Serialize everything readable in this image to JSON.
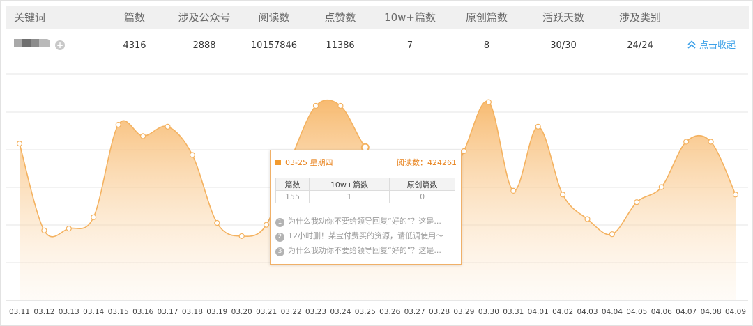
{
  "table": {
    "headers": [
      "关键词",
      "篇数",
      "涉及公众号",
      "阅读数",
      "点赞数",
      "10w+篇数",
      "原创篇数",
      "活跃天数",
      "涉及类别"
    ],
    "row": {
      "plus_icon": "+",
      "values": [
        "4316",
        "2888",
        "10157846",
        "11386",
        "7",
        "8",
        "30/30",
        "24/24"
      ],
      "collapse_label": "点击收起"
    }
  },
  "colors": {
    "line": "#f4b260",
    "fill_top": "#f7b769",
    "tooltip_border": "#f0b068",
    "accent": "#e8821c",
    "link": "#3ea1e8"
  },
  "chart_data": {
    "type": "area",
    "x": [
      "03.11",
      "03.12",
      "03.13",
      "03.14",
      "03.15",
      "03.16",
      "03.17",
      "03.18",
      "03.19",
      "03.20",
      "03.21",
      "03.22",
      "03.23",
      "03.24",
      "03.25",
      "03.26",
      "03.27",
      "03.28",
      "03.29",
      "03.30",
      "03.31",
      "04.01",
      "04.02",
      "04.03",
      "04.04",
      "04.05",
      "04.06",
      "04.07",
      "04.08",
      "04.09"
    ],
    "values": [
      0.83,
      0.37,
      0.38,
      0.44,
      0.93,
      0.87,
      0.92,
      0.77,
      0.41,
      0.34,
      0.4,
      0.75,
      1.03,
      1.03,
      0.81,
      0.68,
      0.5,
      0.49,
      0.79,
      1.05,
      0.58,
      0.92,
      0.56,
      0.43,
      0.35,
      0.52,
      0.6,
      0.84,
      0.84,
      0.56
    ],
    "ylim": [
      0,
      1.2
    ],
    "grid": true,
    "legend": "none",
    "highlight_index": 14
  },
  "tooltip": {
    "date": "03-25 星期四",
    "reads": "阅读数：424261",
    "table_headers": [
      "篇数",
      "10w+篇数",
      "原创篇数"
    ],
    "table_values": [
      "155",
      "1",
      "0"
    ],
    "items": [
      {
        "num": "1",
        "text": "为什么我劝你不要给领导回复“好的”？这是..."
      },
      {
        "num": "2",
        "text": "12小时删！某宝付费买的资源，请低调使用～"
      },
      {
        "num": "3",
        "text": "为什么我劝你不要给领导回复“好的”？这是..."
      }
    ]
  }
}
